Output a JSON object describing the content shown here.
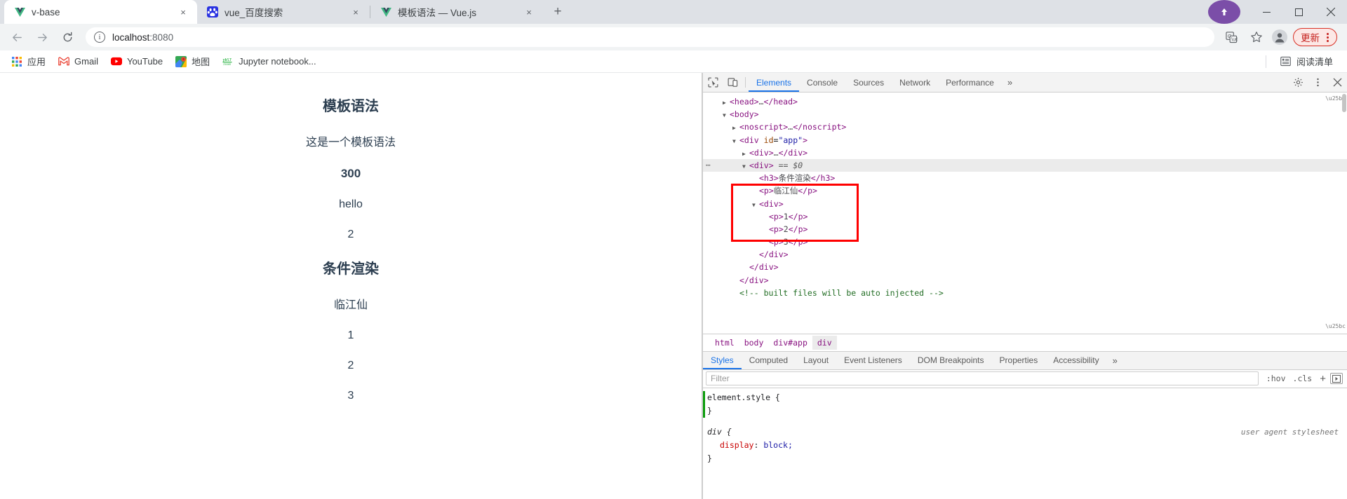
{
  "window": {
    "controls": {
      "minimize": "—",
      "maximize": "☐",
      "close": "✕"
    },
    "update_badge_icon": "purple-circle"
  },
  "tabs": [
    {
      "title": "v-base",
      "favicon": "vue-logo",
      "close": "×",
      "active": true
    },
    {
      "title": "vue_百度搜索",
      "favicon": "baidu-logo",
      "close": "×",
      "active": false
    },
    {
      "title": "模板语法 — Vue.js",
      "favicon": "vue-logo",
      "close": "×",
      "active": false
    }
  ],
  "newtab_label": "+",
  "toolbar": {
    "back": "←",
    "forward": "→",
    "reload": "⟳",
    "info_icon": "i",
    "url_host": "localhost",
    "url_port": ":8080",
    "translate_icon": "translate-icon",
    "bookmark_icon": "☆",
    "profile_icon": "profile-avatar",
    "update_label": "更新",
    "menu_icon": "kebab-menu"
  },
  "bookmarks": {
    "items": [
      {
        "label": "应用",
        "icon": "apps-grid"
      },
      {
        "label": "Gmail",
        "icon": "gmail"
      },
      {
        "label": "YouTube",
        "icon": "youtube"
      },
      {
        "label": "地图",
        "icon": "maps"
      },
      {
        "label": "Jupyter notebook...",
        "icon": "jupyter"
      }
    ],
    "reading_list": {
      "label": "阅读清单",
      "icon": "reading-list-icon"
    }
  },
  "page": {
    "blocks": [
      {
        "tag": "h3",
        "text": "模板语法"
      },
      {
        "tag": "p",
        "text": "这是一个模板语法"
      },
      {
        "tag": "p-bold",
        "text": "300"
      },
      {
        "tag": "p",
        "text": "hello"
      },
      {
        "tag": "p",
        "text": "2"
      },
      {
        "tag": "h3",
        "text": "条件渲染"
      },
      {
        "tag": "p",
        "text": "临江仙"
      },
      {
        "tag": "p",
        "text": "1"
      },
      {
        "tag": "p",
        "text": "2"
      },
      {
        "tag": "p",
        "text": "3"
      }
    ]
  },
  "devtools": {
    "inspect_icon": "inspect-element-icon",
    "device_icon": "device-toolbar-icon",
    "tabs": [
      {
        "label": "Elements",
        "selected": true
      },
      {
        "label": "Console",
        "selected": false
      },
      {
        "label": "Sources",
        "selected": false
      },
      {
        "label": "Network",
        "selected": false
      },
      {
        "label": "Performance",
        "selected": false
      }
    ],
    "overflow": "»",
    "settings_icon": "gear-icon",
    "kebab_icon": "kebab-menu-icon",
    "close_icon": "✕",
    "dom": [
      {
        "indent": 1,
        "tri": "▶",
        "html": "<span class='tag'>&lt;head&gt;</span><span class='ellip'>…</span><span class='tag'>&lt;/head&gt;</span>"
      },
      {
        "indent": 1,
        "tri": "▼",
        "html": "<span class='tag'>&lt;body&gt;</span>"
      },
      {
        "indent": 2,
        "tri": "▶",
        "html": "<span class='tag'>&lt;noscript&gt;</span><span class='ellip'>…</span><span class='tag'>&lt;/noscript&gt;</span>"
      },
      {
        "indent": 2,
        "tri": "▼",
        "html": "<span class='tag'>&lt;div</span> <span class='attr'>id</span>=<span class='aval'>\"app\"</span><span class='tag'>&gt;</span>"
      },
      {
        "indent": 3,
        "tri": "▶",
        "html": "<span class='tag'>&lt;div&gt;</span><span class='ellip'>…</span><span class='tag'>&lt;/div&gt;</span>"
      },
      {
        "indent": 3,
        "tri": "▼",
        "sel": true,
        "dots": true,
        "html": "<span class='tag'>&lt;div&gt;</span> <span class='eq0'>== $0</span>"
      },
      {
        "indent": 4,
        "tri": "",
        "html": "<span class='tag'>&lt;h3&gt;</span><span class='txt'>条件渲染</span><span class='tag'>&lt;/h3&gt;</span>"
      },
      {
        "indent": 4,
        "tri": "",
        "html": "<span class='tag'>&lt;p&gt;</span><span class='txt'>临江仙</span><span class='tag'>&lt;/p&gt;</span>"
      },
      {
        "indent": 4,
        "tri": "▼",
        "html": "<span class='tag'>&lt;div&gt;</span>"
      },
      {
        "indent": 5,
        "tri": "",
        "html": "<span class='tag'>&lt;p&gt;</span><span class='txt'>1</span><span class='tag'>&lt;/p&gt;</span>"
      },
      {
        "indent": 5,
        "tri": "",
        "html": "<span class='tag'>&lt;p&gt;</span><span class='txt'>2</span><span class='tag'>&lt;/p&gt;</span>"
      },
      {
        "indent": 5,
        "tri": "",
        "html": "<span class='tag'>&lt;p&gt;</span><span class='txt'>3</span><span class='tag'>&lt;/p&gt;</span>"
      },
      {
        "indent": 4,
        "tri": "",
        "html": "<span class='tag'>&lt;/div&gt;</span>"
      },
      {
        "indent": 3,
        "tri": "",
        "html": "<span class='tag'>&lt;/div&gt;</span>"
      },
      {
        "indent": 2,
        "tri": "",
        "html": "<span class='tag'>&lt;/div&gt;</span>"
      },
      {
        "indent": 2,
        "tri": "",
        "html": "<span class='cmt'>&lt;!-- built files will be auto injected --&gt;</span>"
      }
    ],
    "breadcrumbs": [
      {
        "label": "html",
        "selected": false
      },
      {
        "label": "body",
        "selected": false
      },
      {
        "label": "div#app",
        "selected": false
      },
      {
        "label": "div",
        "selected": true
      }
    ],
    "pane_tabs": [
      {
        "label": "Styles",
        "selected": true
      },
      {
        "label": "Computed",
        "selected": false
      },
      {
        "label": "Layout",
        "selected": false
      },
      {
        "label": "Event Listeners",
        "selected": false
      },
      {
        "label": "DOM Breakpoints",
        "selected": false
      },
      {
        "label": "Properties",
        "selected": false
      },
      {
        "label": "Accessibility",
        "selected": false
      }
    ],
    "filter": {
      "placeholder": "Filter",
      "hov": ":hov",
      "cls": ".cls",
      "plus": "+",
      "toggle_icon": "element-state-toggle"
    },
    "styles": {
      "element_style_selector": "element.style {",
      "element_style_close": "}",
      "rule_selector": "div {",
      "rule_origin": "user agent stylesheet",
      "prop_name": "display",
      "prop_value": "block;",
      "rule_close": "}"
    }
  },
  "colors": {
    "accent": "#1a73e8",
    "update_red": "#c5221f",
    "highlight_box": "#ff0000",
    "tabstrip_bg": "#dee1e6",
    "toolbar_bg": "#f1f3f4",
    "page_text": "#2c3e50"
  }
}
